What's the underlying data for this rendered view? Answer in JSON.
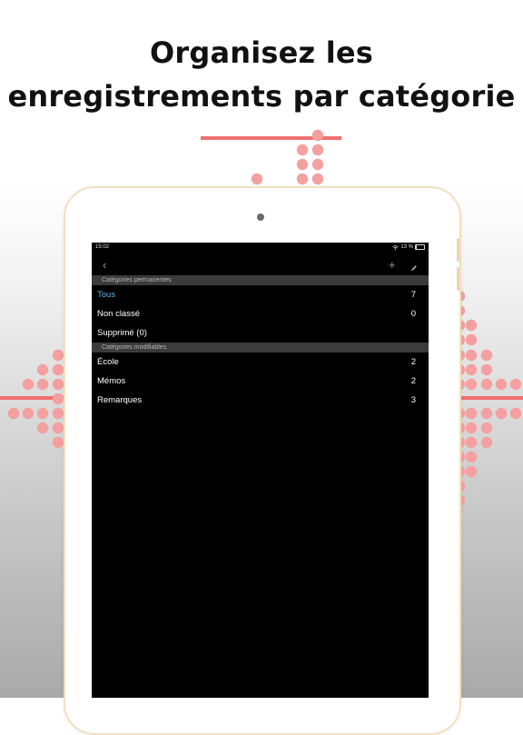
{
  "headline": {
    "line1": "Organisez les",
    "line2": "enregistrements par catégorie"
  },
  "colors": {
    "accent_red": "#f07070",
    "dot_pink": "#f4a0a0",
    "selected_blue": "#5ab4e8"
  },
  "device": {
    "name": "ipad"
  },
  "status_bar": {
    "time": "15:02",
    "battery_text": "13 %",
    "battery_level": 0.13
  },
  "navbar": {
    "back_icon": "chevron-left-icon",
    "add_icon": "plus-icon",
    "edit_icon": "pencil-icon"
  },
  "sections": {
    "permanent": {
      "title": "Catégories permanentes",
      "rows": [
        {
          "label": "Tous",
          "count": "7",
          "selected": true
        },
        {
          "label": "Non classé",
          "count": "0",
          "selected": false
        },
        {
          "label": "Supprimé (0)",
          "count": "",
          "selected": false
        }
      ]
    },
    "editable": {
      "title": "Catégories modifiables",
      "rows": [
        {
          "label": "École",
          "count": "2"
        },
        {
          "label": "Mémos",
          "count": "2"
        },
        {
          "label": "Remarques",
          "count": "3"
        }
      ]
    }
  }
}
